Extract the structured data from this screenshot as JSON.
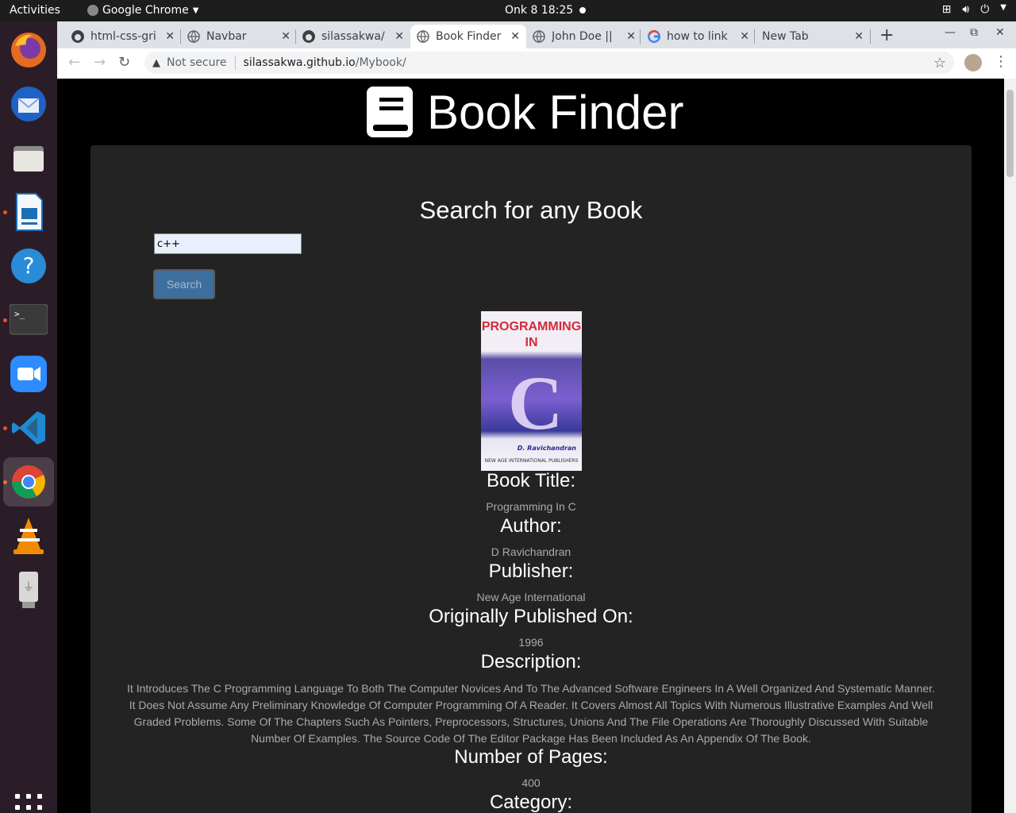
{
  "system": {
    "activities": "Activities",
    "app_name": "Google Chrome",
    "clock": "Onk 8  18:25"
  },
  "tabs": [
    {
      "label": "html-css-gri",
      "icon": "github-icon"
    },
    {
      "label": "Navbar",
      "icon": "globe-icon"
    },
    {
      "label": "silassakwa/",
      "icon": "github-icon"
    },
    {
      "label": "Book Finder",
      "icon": "globe-icon",
      "active": true
    },
    {
      "label": "John Doe ||",
      "icon": "globe-icon"
    },
    {
      "label": "how to link",
      "icon": "google-icon"
    },
    {
      "label": "New Tab",
      "icon": ""
    }
  ],
  "address": {
    "security": "Not secure",
    "host": "silassakwa.github.io",
    "path": "/Mybook/"
  },
  "page": {
    "brand": "Book Finder",
    "heading": "Search for any Book",
    "search_value": "c++",
    "search_button": "Search"
  },
  "cover": {
    "title_line1": "PROGRAMMING",
    "title_line2": "IN",
    "letter": "C",
    "author": "D. Ravichandran",
    "publisher": "NEW AGE INTERNATIONAL PUBLISHERS"
  },
  "book": {
    "title_label": "Book Title:",
    "title": "Programming In C",
    "author_label": "Author:",
    "author": "D Ravichandran",
    "publisher_label": "Publisher:",
    "publisher": "New Age International",
    "published_label": "Originally Published On:",
    "published": "1996",
    "description_label": "Description:",
    "description": "It Introduces The C Programming Language To Both The Computer Novices And To The Advanced Software Engineers In A Well Organized And Systematic Manner. It Does Not Assume Any Preliminary Knowledge Of Computer Programming Of A Reader. It Covers Almost All Topics With Numerous Illustrative Examples And Well Graded Problems. Some Of The Chapters Such As Pointers, Preprocessors, Structures, Unions And The File Operations Are Thoroughly Discussed With Suitable Number Of Examples. The Source Code Of The Editor Package Has Been Included As An Appendix Of The Book.",
    "pages_label": "Number of Pages:",
    "pages": "400",
    "category_label": "Category:"
  },
  "colors": {
    "panel": "#232323",
    "button": "#3d6f9e",
    "dock": "#2b1d28"
  }
}
